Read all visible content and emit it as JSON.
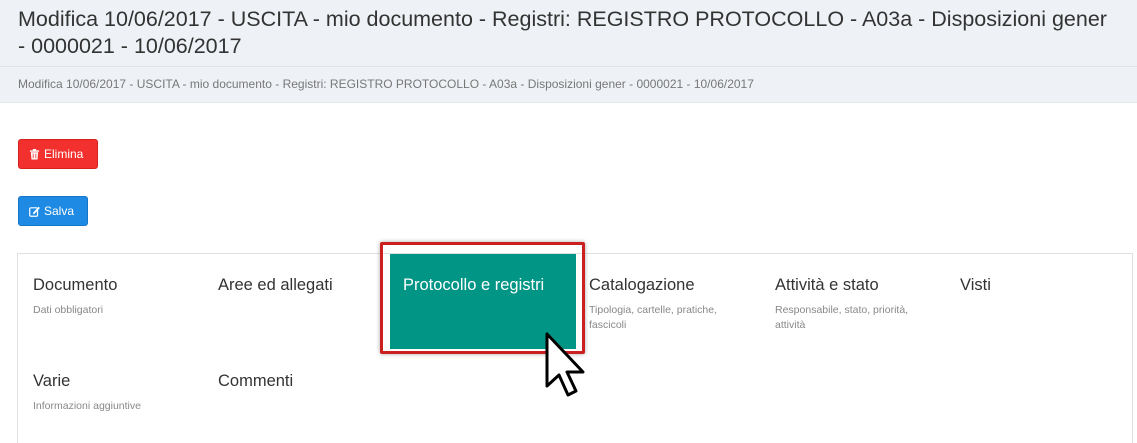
{
  "header": {
    "title": "Modifica 10/06/2017 - USCITA - mio documento - Registri: REGISTRO PROTOCOLLO - A03a - Disposizioni gener - 0000021 - 10/06/2017"
  },
  "breadcrumb": {
    "text": "Modifica 10/06/2017 - USCITA - mio documento - Registri: REGISTRO PROTOCOLLO - A03a - Disposizioni gener - 0000021 - 10/06/2017"
  },
  "actions": {
    "delete_label": "Elimina",
    "delete_icon": "trash-icon",
    "save_label": "Salva",
    "save_icon": "edit-icon"
  },
  "tabs": [
    {
      "label": "Documento",
      "sub": "Dati obbligatori"
    },
    {
      "label": "Aree ed allegati",
      "sub": ""
    },
    {
      "label": "Protocollo e registri",
      "sub": "",
      "active": true
    },
    {
      "label": "Catalogazione",
      "sub": "Tipologia, cartelle, pratiche, fascicoli"
    },
    {
      "label": "Attività e stato",
      "sub": "Responsabile, stato, priorità, attività"
    },
    {
      "label": "Visti",
      "sub": ""
    },
    {
      "label": "Varie",
      "sub": "Informazioni aggiuntive"
    },
    {
      "label": "Commenti",
      "sub": ""
    }
  ],
  "colors": {
    "danger": "#f2312f",
    "primary": "#1f8ae3",
    "active_tab": "#009585",
    "highlight": "#cc1f1f"
  }
}
